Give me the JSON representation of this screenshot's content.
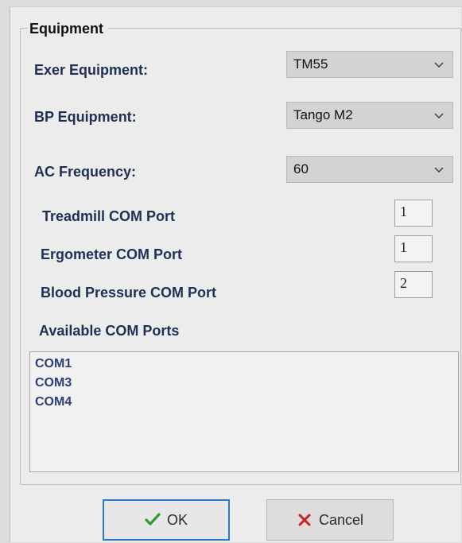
{
  "group": {
    "title": "Equipment"
  },
  "fields": {
    "exer_equipment_label": "Exer Equipment:",
    "exer_equipment_value": "TM55",
    "bp_equipment_label": "BP Equipment:",
    "bp_equipment_value": "Tango M2",
    "ac_frequency_label": "AC Frequency:",
    "ac_frequency_value": "60",
    "treadmill_com_label": "Treadmill COM Port",
    "treadmill_com_value": "1",
    "ergometer_com_label": "Ergometer COM Port",
    "ergometer_com_value": "1",
    "bp_com_label": "Blood Pressure COM Port",
    "bp_com_value": "2",
    "available_ports_label": "Available COM Ports",
    "ports": [
      "COM1",
      "COM3",
      "COM4"
    ]
  },
  "buttons": {
    "ok_label": "OK",
    "cancel_label": "Cancel"
  },
  "icons": {
    "dropdown": "chevron-down-icon",
    "ok": "check-icon",
    "cancel": "close-icon"
  },
  "colors": {
    "label_text": "#1f2f55",
    "ok_border": "#2a78c8",
    "ok_icon": "#2f9a2f",
    "cancel_icon": "#c82424",
    "listbox_text": "#2d3e79"
  }
}
